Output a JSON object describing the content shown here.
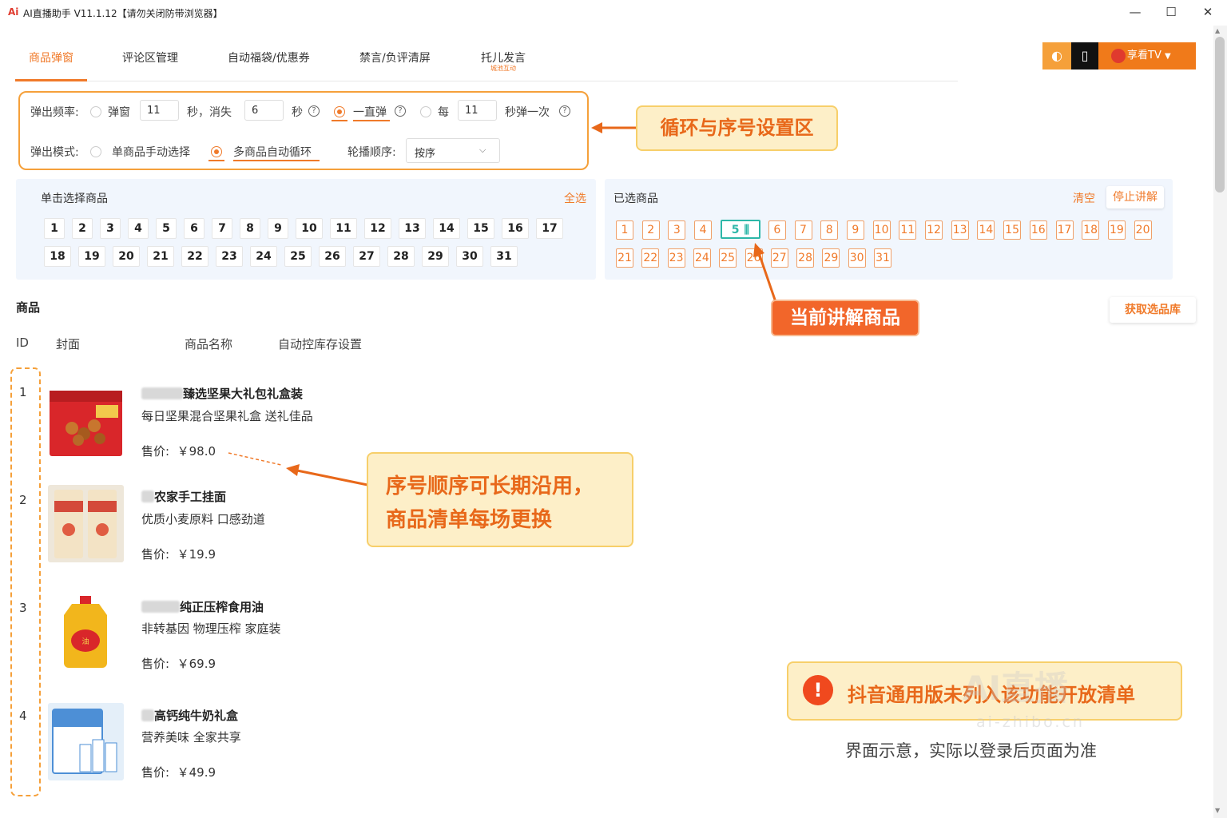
{
  "window": {
    "logo": "Ai",
    "title": "AI直播助手 V11.1.12【请勿关闭防带浏览器】",
    "minimize": "—",
    "maximize": "☐",
    "close": "✕"
  },
  "tabs": [
    {
      "label": "商品弹窗",
      "active": true
    },
    {
      "label": "评论区管理"
    },
    {
      "label": "自动福袋/优惠券"
    },
    {
      "label": "禁言/负评清屏"
    },
    {
      "label": "托儿发言",
      "sub": "城池互动"
    }
  ],
  "top_right": {
    "left_icon": "◐",
    "phone_icon": "▯",
    "account": "享看TV",
    "caret": "▼"
  },
  "settings": {
    "freq_label": "弹出频率:",
    "opt_popup": "弹窗",
    "popup_sec": "11",
    "sec_dismiss": "秒，消失",
    "dismiss_sec": "6",
    "sec": "秒",
    "opt_always": "一直弹",
    "opt_every": "每",
    "every_sec": "11",
    "every_suffix": "秒弹一次",
    "help": "?",
    "mode_label": "弹出模式:",
    "opt_single": "单商品手动选择",
    "opt_multi": "多商品自动循环",
    "order_label": "轮播顺序:",
    "order_value": "按序",
    "order_arrow": "⌵"
  },
  "callouts": {
    "loop_settings": "循环与序号设置区",
    "current": "当前讲解商品",
    "seq_line1": "序号顺序可长期沿用，",
    "seq_line2": "商品清单每场更换"
  },
  "pick_panel": {
    "title": "单击选择商品",
    "select_all": "全选",
    "row1": [
      "1",
      "2",
      "3",
      "4",
      "5",
      "6",
      "7",
      "8",
      "9",
      "10",
      "11",
      "12",
      "13",
      "14",
      "15",
      "16",
      "17"
    ],
    "row2": [
      "18",
      "19",
      "20",
      "21",
      "22",
      "23",
      "24",
      "25",
      "26",
      "27",
      "28",
      "29",
      "30",
      "31"
    ]
  },
  "selected_panel": {
    "title": "已选商品",
    "clear": "清空",
    "stop": "停止讲解",
    "row1": [
      "1",
      "2",
      "3",
      "4",
      "5",
      "6",
      "7",
      "8",
      "9",
      "10",
      "11",
      "12",
      "13",
      "14",
      "15",
      "16",
      "17",
      "18",
      "19",
      "20"
    ],
    "row2": [
      "21",
      "22",
      "23",
      "24",
      "25",
      "26",
      "27",
      "28",
      "29",
      "30",
      "31"
    ],
    "current": "5",
    "playing_icon": "⫼"
  },
  "products_section": {
    "title": "商品",
    "fetch": "获取选品库",
    "columns": {
      "id": "ID",
      "cover": "封面",
      "name": "商品名称",
      "stock": "自动控库存设置"
    }
  },
  "products": [
    {
      "id": "1",
      "name": "臻选坚果大礼包礼盒装",
      "desc": "每日坚果混合坚果礼盒 送礼佳品",
      "price_label": "售价:",
      "price": "￥98.0"
    },
    {
      "id": "2",
      "name": "农家手工挂面",
      "desc": "优质小麦原料 口感劲道",
      "price_label": "售价:",
      "price": "￥19.9"
    },
    {
      "id": "3",
      "name": "纯正压榨食用油",
      "desc": "非转基因 物理压榨 家庭装",
      "price_label": "售价:",
      "price": "￥69.9"
    },
    {
      "id": "4",
      "name": "高钙纯牛奶礼盒",
      "desc": "营养美味 全家共享",
      "price_label": "售价:",
      "price": "￥49.9"
    }
  ],
  "notice": {
    "icon": "!",
    "text": "抖音通用版未列入该功能开放清单",
    "disclaimer": "界面示意，实际以登录后页面为准"
  },
  "watermark": {
    "mark": "AI直播",
    "site": "ai-zhibo.cn"
  },
  "colors": {
    "accent": "#f07a2a",
    "current": "#2db7a8",
    "callout_bg": "#fdefc8",
    "callout_border": "#f7cf6a",
    "panel_bg": "#f1f6fd"
  }
}
